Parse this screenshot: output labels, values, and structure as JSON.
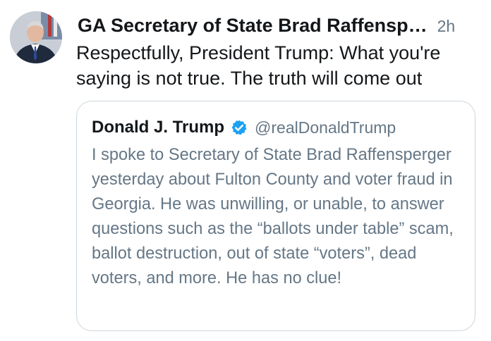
{
  "tweet": {
    "author_name": "GA Secretary of State Brad Raffensp…",
    "timestamp": "2h",
    "text": "Respectfully, President Trump: What you're saying is not true. The truth will come out"
  },
  "quoted_tweet": {
    "author_name": "Donald J. Trump",
    "verified_icon": "verified-badge-icon",
    "handle": "@realDonaldTrump",
    "text": "I spoke to Secretary of State Brad Raffensperger yesterday about Fulton County and voter fraud in Georgia. He was unwilling, or unable, to answer questions such as the “ballots under table” scam, ballot destruction, out of state “voters”, dead voters, and more. He has no clue!"
  },
  "colors": {
    "text_primary": "#14171a",
    "text_secondary": "#657786",
    "border": "#ccd6dd",
    "verified_blue": "#1da1f2"
  }
}
